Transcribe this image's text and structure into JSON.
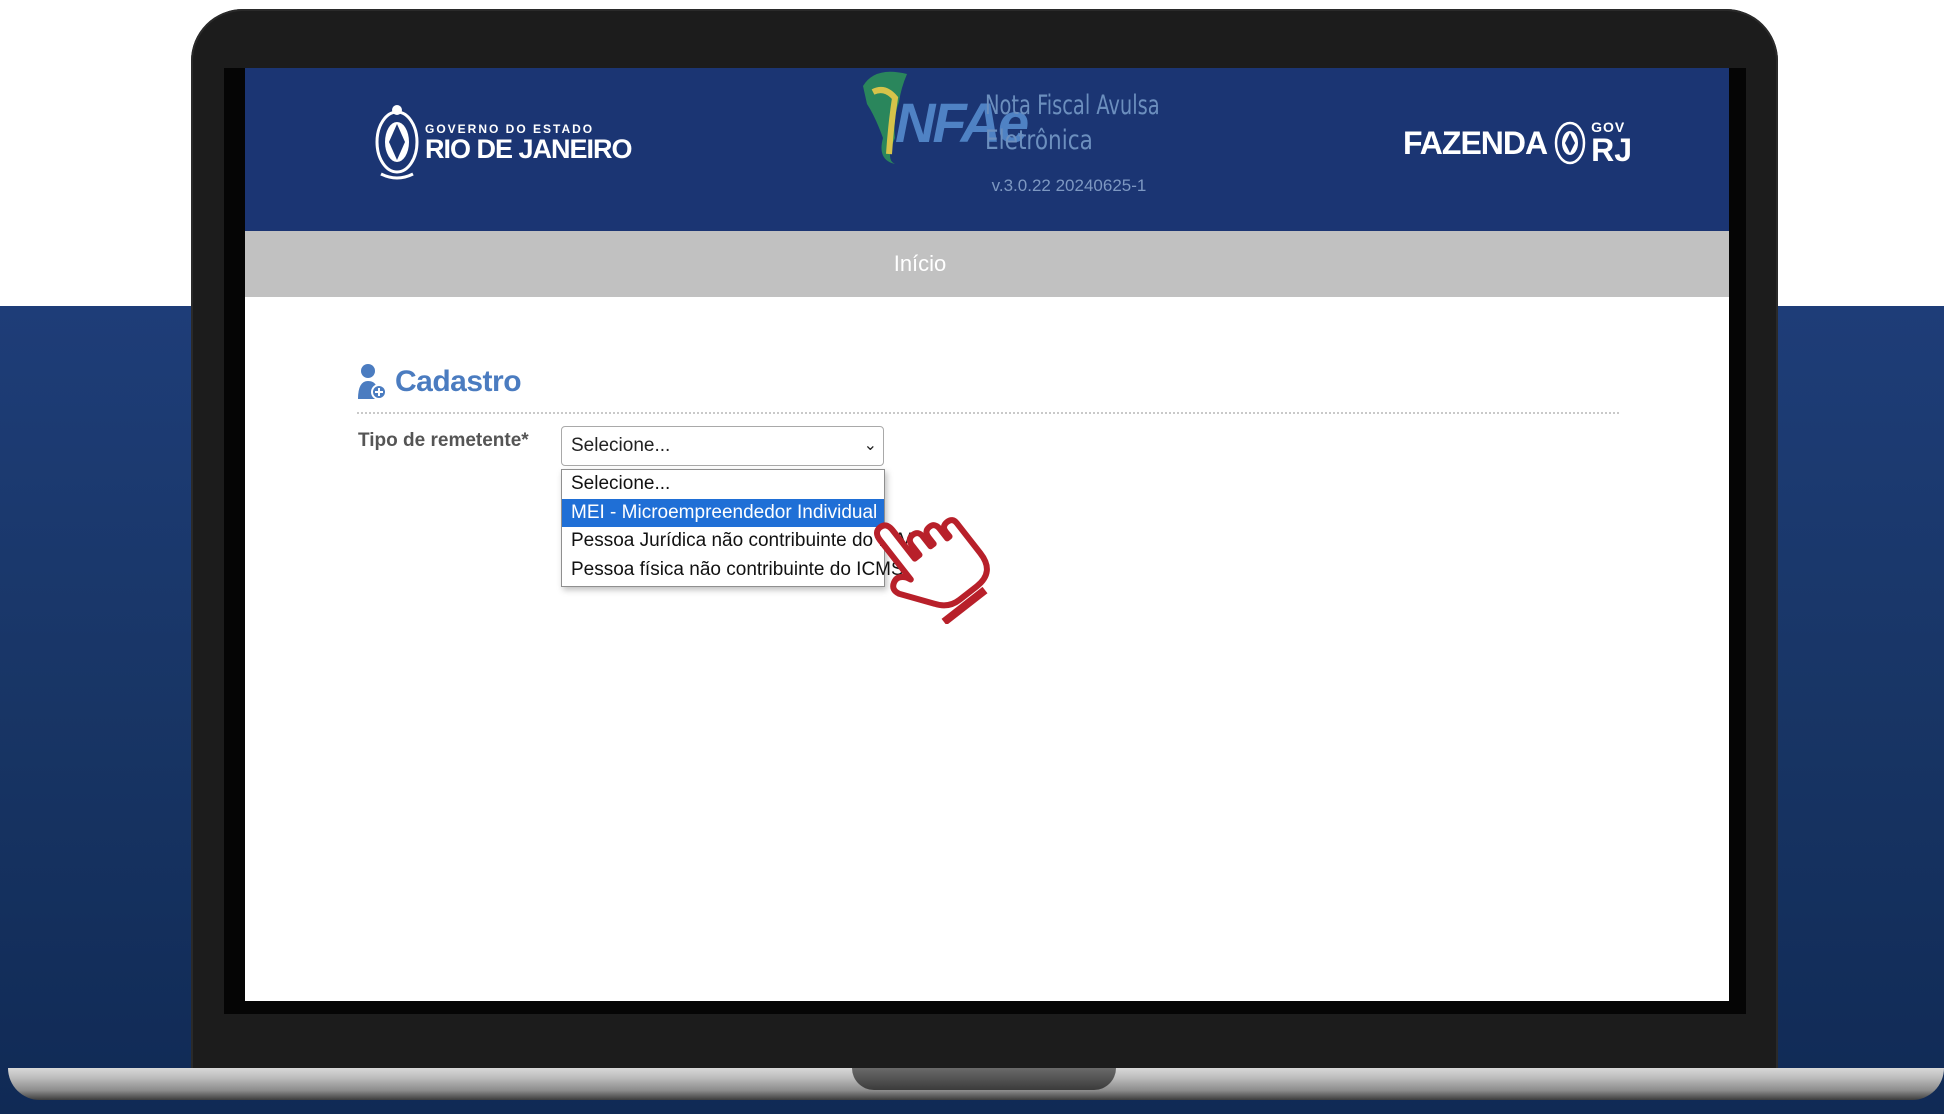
{
  "header": {
    "gov_small": "GOVERNO DO ESTADO",
    "gov_big": "RIO DE JANEIRO",
    "app_mark": "NFAe",
    "app_name_line1": "Nota Fiscal Avulsa",
    "app_name_line2": "Eletrônica",
    "version": "v.3.0.22 20240625-1",
    "fazenda": "FAZENDA",
    "gov_label": "GOV",
    "rj_label": "RJ"
  },
  "nav": {
    "home": "Início"
  },
  "section": {
    "title": "Cadastro"
  },
  "form": {
    "label": "Tipo de remetente*",
    "selected": "Selecione...",
    "chevron": "⌄",
    "options": [
      "Selecione...",
      "MEI - Microempreendedor Individual",
      "Pessoa Jurídica não contribuinte do ICMS",
      "Pessoa física não contribuinte do ICMS"
    ],
    "highlighted_index": 1
  },
  "icons": {
    "user": "user-icon",
    "cursor": "hand-pointer-icon",
    "seal": "state-seal-icon"
  },
  "colors": {
    "header_bg": "#1b3573",
    "nav_bg": "#c1c1c1",
    "accent": "#4b7cc0",
    "highlight": "#1f6fd6",
    "cursor": "#b8202a"
  }
}
